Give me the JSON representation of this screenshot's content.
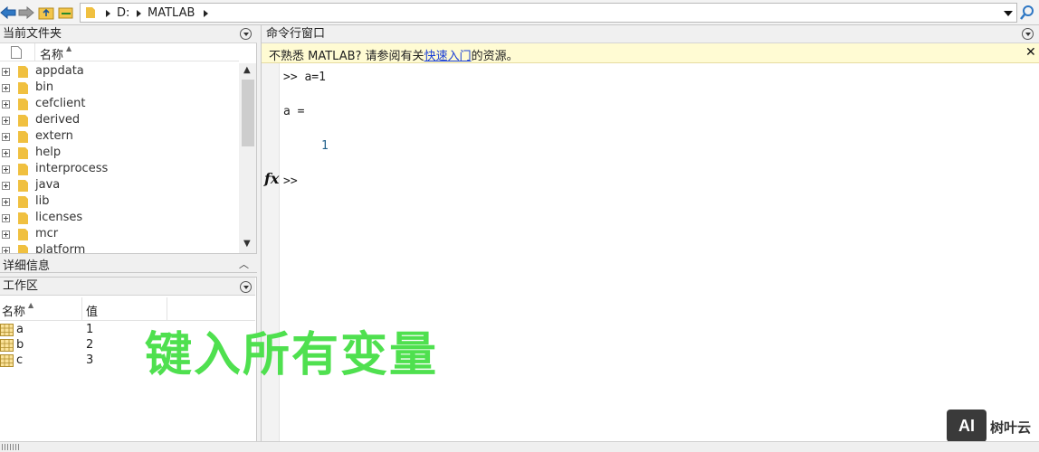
{
  "address_bar": {
    "path": [
      "D:",
      "MATLAB"
    ]
  },
  "current_folder": {
    "title": "当前文件夹",
    "column_name": "名称",
    "items": [
      "appdata",
      "bin",
      "cefclient",
      "derived",
      "extern",
      "help",
      "interprocess",
      "java",
      "lib",
      "licenses",
      "mcr",
      "platform"
    ]
  },
  "details": {
    "title": "详细信息"
  },
  "workspace": {
    "title": "工作区",
    "col_name": "名称",
    "col_value": "值",
    "rows": [
      {
        "name": "a",
        "value": "1"
      },
      {
        "name": "b",
        "value": "2"
      },
      {
        "name": "c",
        "value": "3"
      }
    ]
  },
  "command_window": {
    "title": "命令行窗口",
    "info_prefix": "不熟悉 MATLAB? 请参阅有关",
    "info_link": "快速入门",
    "info_suffix": "的资源。",
    "lines": {
      "cmd": ">> a=1",
      "var": "a =",
      "val": "1",
      "prompt": ">>"
    },
    "fx_label": "fx"
  },
  "overlay": {
    "caption": "键入所有变量"
  },
  "watermark": {
    "logo": "AI",
    "text": "树叶云"
  },
  "colors": {
    "accent": "#1565c0",
    "link": "#1a3fd6",
    "info_bg": "#fffbd3",
    "overlay": "#4fe04f",
    "folder": "#f0c040"
  }
}
